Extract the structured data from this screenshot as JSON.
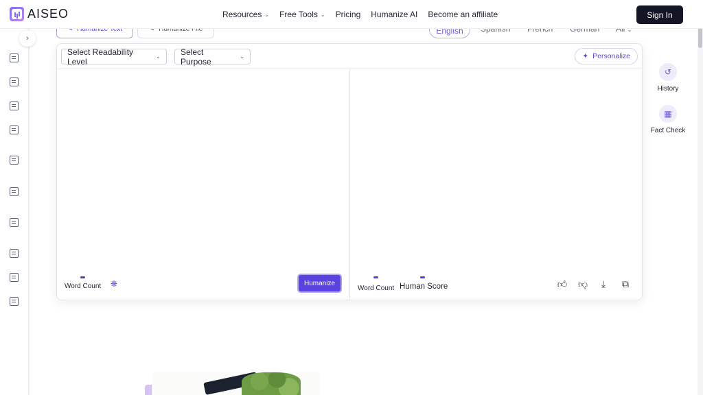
{
  "header": {
    "logo_text": "AISEO",
    "nav": [
      {
        "label": "Resources",
        "has_dropdown": true
      },
      {
        "label": "Free Tools",
        "has_dropdown": true
      },
      {
        "label": "Pricing",
        "has_dropdown": false
      },
      {
        "label": "Humanize AI",
        "has_dropdown": false
      },
      {
        "label": "Become an affiliate",
        "has_dropdown": false
      }
    ],
    "signin_label": "Sign In"
  },
  "mode_tabs": [
    "Humanize Text",
    "Humanize File"
  ],
  "languages": [
    "English",
    "Spanish",
    "French",
    "German",
    "All"
  ],
  "toolbar": {
    "readability_label": "Select Readability Level",
    "purpose_label": "Select Purpose",
    "personalize_label": "Personalize"
  },
  "input_panel": {
    "word_count_label": "Word Count",
    "humanize_label": "Humanize"
  },
  "output_panel": {
    "word_count_label": "Word Count",
    "human_score_label": "Human Score"
  },
  "right_rail": [
    {
      "label": "History",
      "icon": "history-icon"
    },
    {
      "label": "Fact Check",
      "icon": "fact-check-icon"
    }
  ],
  "colors": {
    "accent": "#5842e0",
    "signin_bg": "#141625"
  }
}
